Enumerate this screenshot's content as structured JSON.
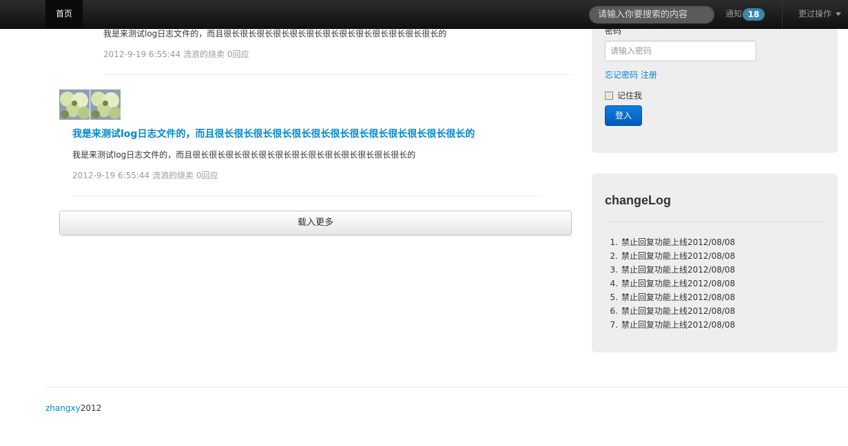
{
  "navbar": {
    "home_label": "首页",
    "search_placeholder": "请输入你要搜索的内容",
    "notify_label": "通知",
    "notify_count": "18",
    "more_ops_label": "更过操作"
  },
  "feed": {
    "posts": [
      {
        "title": "",
        "description": "我是来测试log日志文件的，而且很长很长很长很长很长很长很长很长很长很长很长很长很长的",
        "date": "2012-9-19 6:55:44",
        "author": "流浪的烧卖",
        "replies": "0回应"
      },
      {
        "title": "我是来测试log日志文件的，而且很长很长很长很长很长很长很长很长很长很长很长很长很长的",
        "description": "我是来测试log日志文件的，而且很长很长很长很长很长很长很长很长很长很长很长很长很长的",
        "date": "2012-9-19 6:55:44",
        "author": "流浪的烧卖",
        "replies": "0回应"
      }
    ],
    "load_more_label": "载入更多"
  },
  "login": {
    "password_label": "密码",
    "password_placeholder": "请输入密码",
    "forgot_label": "忘记密码",
    "register_label": "注册",
    "remember_label": "记住我",
    "login_label": "登入"
  },
  "changelog": {
    "title": "changeLog",
    "items": [
      {
        "num": "1.",
        "text": "禁止回复功能上线2012/08/08"
      },
      {
        "num": "2.",
        "text": "禁止回复功能上线2012/08/08"
      },
      {
        "num": "3.",
        "text": "禁止回复功能上线2012/08/08"
      },
      {
        "num": "4.",
        "text": "禁止回复功能上线2012/08/08"
      },
      {
        "num": "5.",
        "text": "禁止回复功能上线2012/08/08"
      },
      {
        "num": "6.",
        "text": "禁止回复功能上线2012/08/08"
      },
      {
        "num": "7.",
        "text": "禁止回复功能上线2012/08/08"
      }
    ]
  },
  "footer": {
    "author_link": "zhangxy",
    "year": "2012"
  },
  "colors": {
    "link": "#0088cc",
    "badge": "#3a87ad",
    "navbar": "#1b1b1b",
    "well": "#eeeeee",
    "primary_button": "#0a6ed1"
  }
}
